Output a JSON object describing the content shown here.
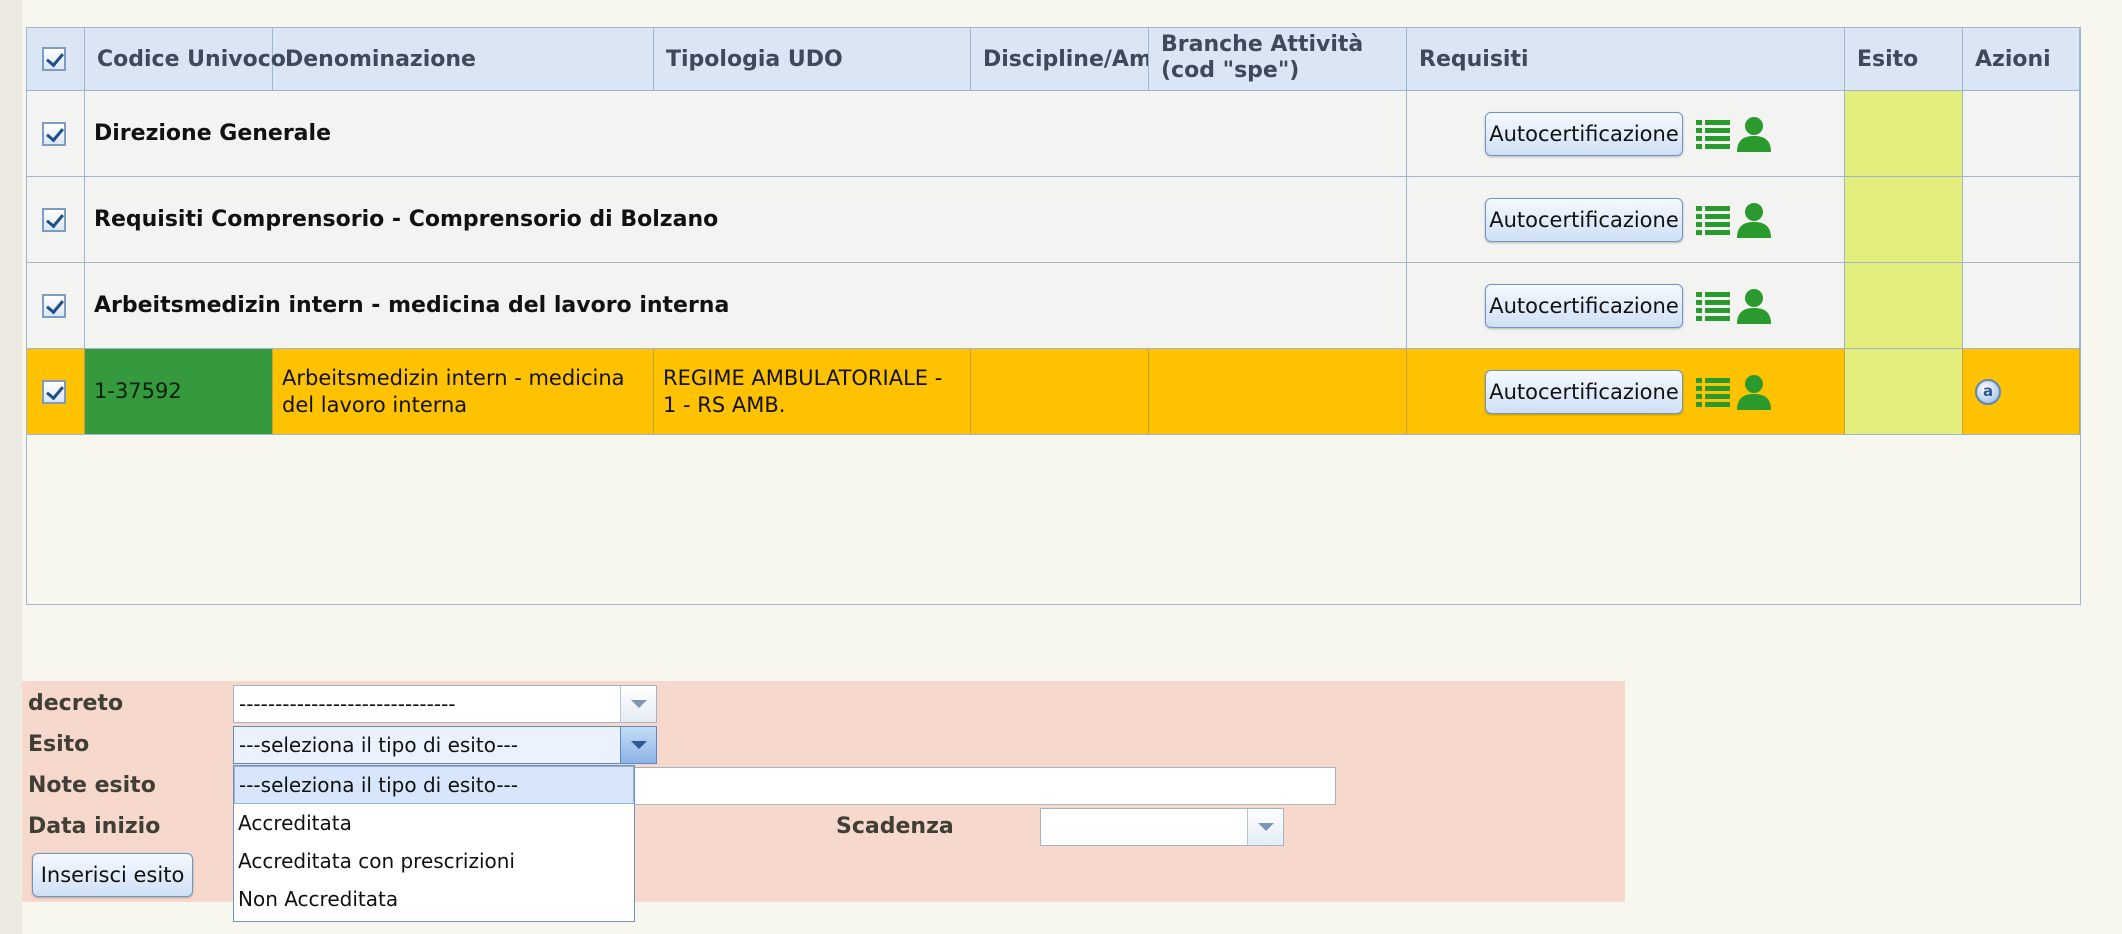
{
  "grid": {
    "columns": {
      "select": "",
      "codice": "Codice Univoco",
      "denominazione": "Denominazione",
      "tipologia": "Tipologia UDO",
      "discipline": "Discipline/Ambiti",
      "branche": "Branche Attività (cod \"spe\")",
      "requisiti": "Requisiti",
      "esito": "Esito",
      "azioni": "Azioni"
    },
    "group_rows": [
      {
        "title": "Direzione Generale",
        "button": "Autocertificazione"
      },
      {
        "title": "Requisiti Comprensorio - Comprensorio di Bolzano",
        "button": "Autocertificazione"
      },
      {
        "title": "Arbeitsmedizin intern - medicina del lavoro interna",
        "button": "Autocertificazione"
      }
    ],
    "detail_row": {
      "codice": "1-37592",
      "denominazione": "Arbeitsmedizin intern - medicina del lavoro interna",
      "tipologia": "REGIME AMBULATORIALE - 1 - RS AMB.",
      "discipline": "",
      "branche": "",
      "button": "Autocertificazione",
      "action_icon": "a"
    }
  },
  "form": {
    "decreto_label": "decreto",
    "decreto_value": "------------------------------",
    "esito_label": "Esito",
    "esito_value": "---seleziona il tipo di esito---",
    "note_label": "Note esito",
    "data_inizio_label": "Data inizio",
    "scadenza_label": "Scadenza",
    "submit_label": "Inserisci esito",
    "esito_options": [
      "---seleziona il tipo di esito---",
      "Accreditata",
      "Accreditata con prescrizioni",
      "Non Accreditata"
    ]
  },
  "icons": {
    "list": "list-icon",
    "person": "person-icon",
    "detail": "info-circle-icon",
    "checkbox": "checkbox-checked-icon"
  },
  "colors": {
    "header_bg": "#dbe6f5",
    "highlight_row": "#ffc200",
    "code_cell": "#359a3e",
    "esito_cell": "#e3ee7c",
    "form_bg": "#f7d8cd",
    "icon_green": "#2a9a2e"
  }
}
